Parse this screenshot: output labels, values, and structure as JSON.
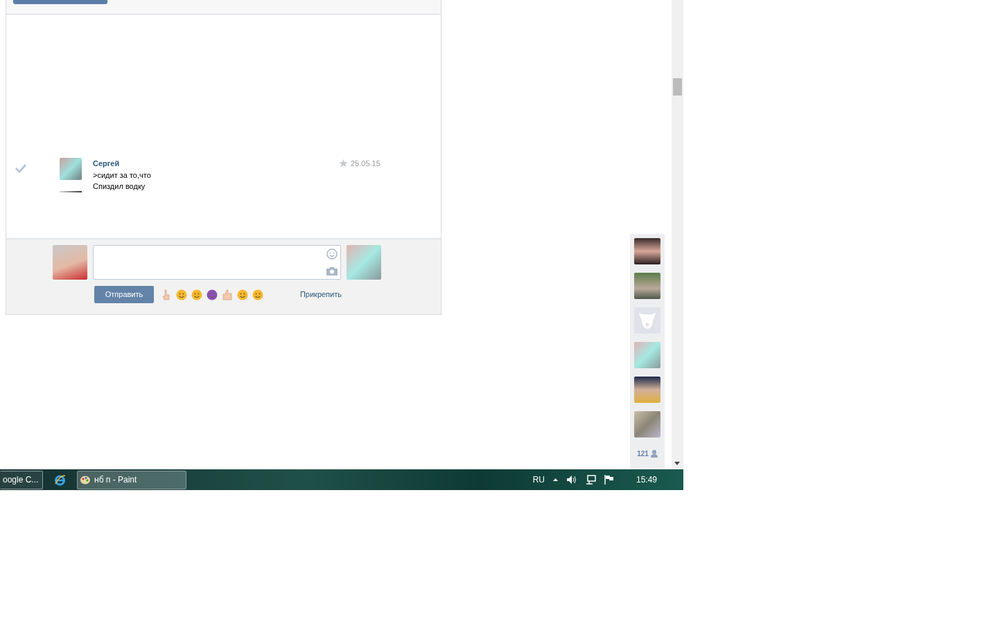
{
  "messages": [
    {
      "author": "Сергей",
      "date": "25.05.15",
      "lines": [
        ">сидит за то,что",
        "Спиздил водку"
      ],
      "read": true,
      "starred": false
    }
  ],
  "composer": {
    "send_label": "Отправить",
    "attach_label": "Прикрепить"
  },
  "friends": {
    "avatars": [
      {
        "kind": "photo"
      },
      {
        "kind": "photo"
      },
      {
        "kind": "default"
      },
      {
        "kind": "photo"
      },
      {
        "kind": "photo"
      },
      {
        "kind": "photo"
      }
    ],
    "count": "121"
  },
  "taskbar": {
    "items": [
      {
        "kind": "app",
        "label": "oogle C...",
        "selected": false
      },
      {
        "kind": "icon",
        "selected": false
      },
      {
        "kind": "app",
        "label": "нб п - Paint",
        "selected": true
      }
    ],
    "language": "RU",
    "time": "15:49"
  }
}
